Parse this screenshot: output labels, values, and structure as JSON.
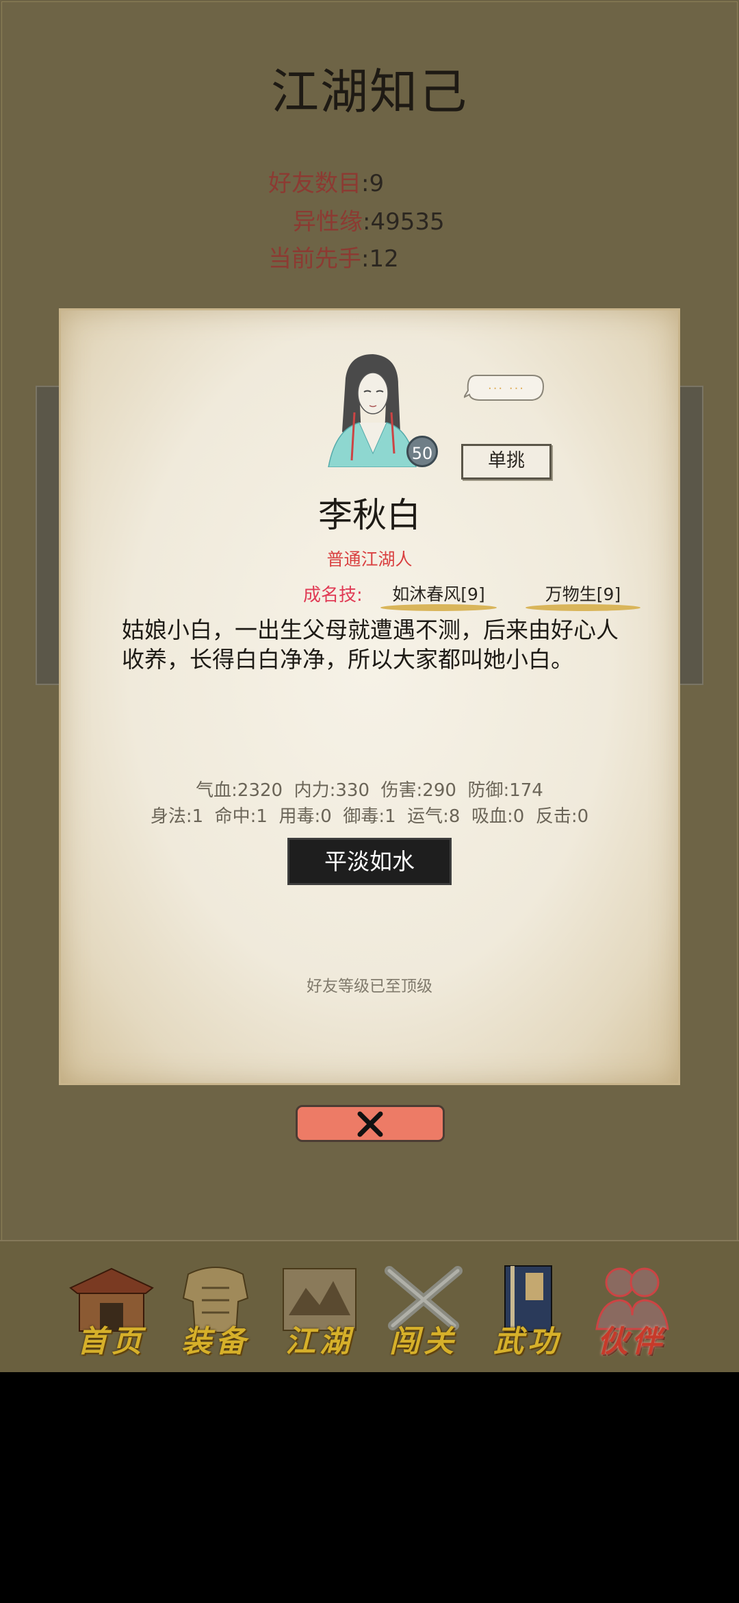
{
  "page": {
    "title": "江湖知己"
  },
  "summary": [
    {
      "key": "好友数目",
      "value": ":9"
    },
    {
      "key": "异性缘",
      "value": ":49535"
    },
    {
      "key": "当前先手",
      "value": ":12"
    }
  ],
  "card": {
    "level": "50",
    "speech": "... ...",
    "duel_label": "单挑",
    "name": "李秋白",
    "rank": "普通江湖人",
    "skills_label": "成名技:",
    "skills": [
      "如沐春风[9]",
      "万物生[9]"
    ],
    "bio": "姑娘小白，一出生父母就遭遇不测，后来由好心人收养，长得白白净净，所以大家都叫她小白。",
    "stats_line1": "气血:2320  内力:330  伤害:290  防御:174",
    "stats_line2": "身法:1  命中:1  用毒:0  御毒:1  运气:8  吸血:0  反击:0",
    "mood_button": "平淡如水",
    "friend_note": "好友等级已至顶级"
  },
  "nav": [
    {
      "label": "首页",
      "icon": "house-icon"
    },
    {
      "label": "装备",
      "icon": "armor-icon"
    },
    {
      "label": "江湖",
      "icon": "scroll-map-icon"
    },
    {
      "label": "闯关",
      "icon": "crossed-swords-icon"
    },
    {
      "label": "武功",
      "icon": "martial-book-icon"
    },
    {
      "label": "伙伴",
      "icon": "companions-icon",
      "active": true
    }
  ],
  "colors": {
    "background": "#6e6446",
    "accent_red": "#8c3a32",
    "skill_red": "#e03b55",
    "close_button": "#ed7b66",
    "nav_gold": "#d6b02a"
  }
}
